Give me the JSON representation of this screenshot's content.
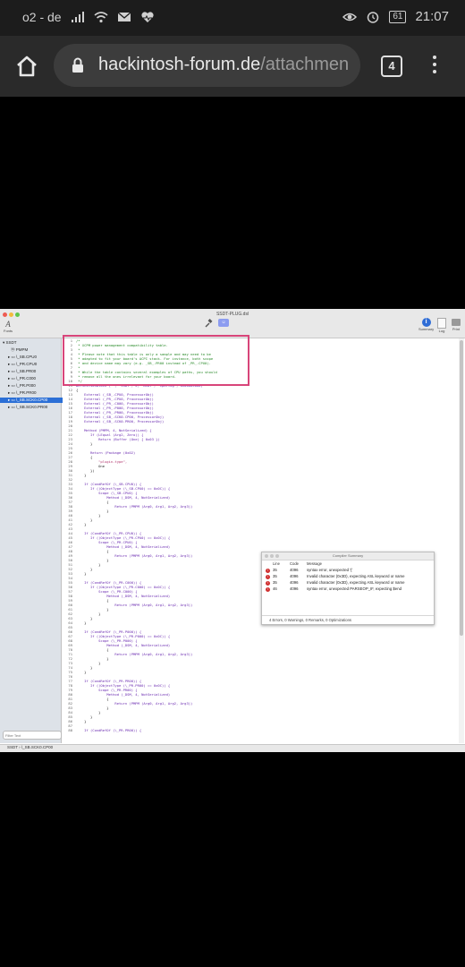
{
  "statusbar": {
    "carrier": "o2 - de",
    "battery": "61",
    "time": "21:07"
  },
  "browser": {
    "url_domain": "hackintosh-forum.de",
    "url_path": "/attachmen",
    "tab_count": "4"
  },
  "window": {
    "title": "SSDT-PLUG.dsl",
    "toolbar_left": "Fonts",
    "toolbar_right": [
      "Summary",
      "Log",
      "Print"
    ]
  },
  "sidebar": {
    "items": [
      "SSDT",
      "PMPM",
      "\\_SB.CPU0",
      "\\_PR.CPU0",
      "\\_SB.PR00",
      "\\_PR.C000",
      "\\_PR.P000",
      "\\_PR.PR00",
      "\\_SB.SCK0.CP00",
      "\\_SB.SCK0.PR00"
    ],
    "selected_index": 8,
    "filter_placeholder": "Filter Text"
  },
  "statusline": "SSDT › \\_SB.SCK0.CP00",
  "code_lines": [
    "/*",
    " * XCPM power management compatibility table.",
    " *",
    " * Please note that this table is only a sample and may need to be",
    " * adapted to fit your board's ACPI stack. For instance, both scope",
    " * and device name may vary (e.g. _SB_.PR00 instead of _PR_.CPU0).",
    " *",
    " * While the table contains several examples of CPU paths, you should",
    " * remove all the ones irrelevant for your board.",
    " */",
    "DefinitionBlock (\"\", \"SSDT\", 2, \"ACDT\", \"CpuPlug\", 0x00003000)",
    "{",
    "    External (_SB_.CPU0, ProcessorObj)",
    "    External (_PR_.CPU0, ProcessorObj)",
    "    External (_PR_.C000, ProcessorObj)",
    "    External (_PR_.P000, ProcessorObj)",
    "    External (_PR_.PR00, ProcessorObj)",
    "    External (_SB_.SCK0.CP00, ProcessorObj)",
    "    External (_SB_.SCK0.PR00, ProcessorObj)",
    "",
    "    Method (PMPM, 4, NotSerialized) {",
    "       If (LEqual (Arg2, Zero)) {",
    "           Return (Buffer (One) { 0x03 })",
    "       }",
    "",
    "       Return (Package (0x02)",
    "       {",
    "           \"plugin-type\",",
    "           One",
    "       })",
    "    }",
    "",
    "    If (CondRefOf (\\_SB.CPU0)) {",
    "       If ((ObjectType (\\_SB.CPU0) == 0x0C)) {",
    "           Scope (\\_SB.CPU0) {",
    "               Method (_DSM, 4, NotSerialized)",
    "               {",
    "                   Return (PMPM (Arg0, Arg1, Arg2, Arg3))",
    "               }",
    "           }",
    "       }",
    "    }",
    "",
    "    If (CondRefOf (\\_PR.CPU0)) {",
    "       If ((ObjectType (\\_PR.CPU0) == 0x0C)) {",
    "           Scope (\\_PR.CPU0) {",
    "               Method (_DSM, 4, NotSerialized)",
    "               {",
    "                   Return (PMPM (Arg0, Arg1, Arg2, Arg3))",
    "               }",
    "           }",
    "       }",
    "    }",
    "",
    "    If (CondRefOf (\\_PR.C000)) {",
    "       If ((ObjectType (\\_PR.C000) == 0x0C)) {",
    "           Scope (\\_PR.C000) {",
    "               Method (_DSM, 4, NotSerialized)",
    "               {",
    "                   Return (PMPM (Arg0, Arg1, Arg2, Arg3))",
    "               }",
    "           }",
    "       }",
    "    }",
    "",
    "    If (CondRefOf (\\_PR.P000)) {",
    "       If ((ObjectType (\\_PR.P000) == 0x0C)) {",
    "           Scope (\\_PR.P000) {",
    "               Method (_DSM, 4, NotSerialized)",
    "               {",
    "                   Return (PMPM (Arg0, Arg1, Arg2, Arg3))",
    "               }",
    "           }",
    "       }",
    "    }",
    "",
    "    If (CondRefOf (\\_PR.PR00)) {",
    "       If ((ObjectType (\\_PR.PR00) == 0x0C)) {",
    "           Scope (\\_PR.PR00) {",
    "               Method (_DSM, 4, NotSerialized)",
    "               {",
    "                   Return (PMPM (Arg0, Arg1, Arg2, Arg3))",
    "               }",
    "           }",
    "       }",
    "    }",
    "",
    "    If (CondRefOf (\\_PR.PR00)) {"
  ],
  "compiler": {
    "title": "Compiler Summary",
    "headers": {
      "line": "Line",
      "code": "Code",
      "message": "Message"
    },
    "rows": [
      {
        "line": "35",
        "code": "4096",
        "message": "syntax error, unexpected '{'"
      },
      {
        "line": "35",
        "code": "4096",
        "message": "Invalid character (0x3D), expecting ASL keyword or name"
      },
      {
        "line": "35",
        "code": "4096",
        "message": "Invalid character (0x3D), expecting ASL keyword or name"
      },
      {
        "line": "46",
        "code": "4096",
        "message": "syntax error, unexpected PARSEOP_IF, expecting $end"
      }
    ],
    "footer": "4 Errors, 0 Warnings, 0 Remarks, 0 Optimizations"
  }
}
